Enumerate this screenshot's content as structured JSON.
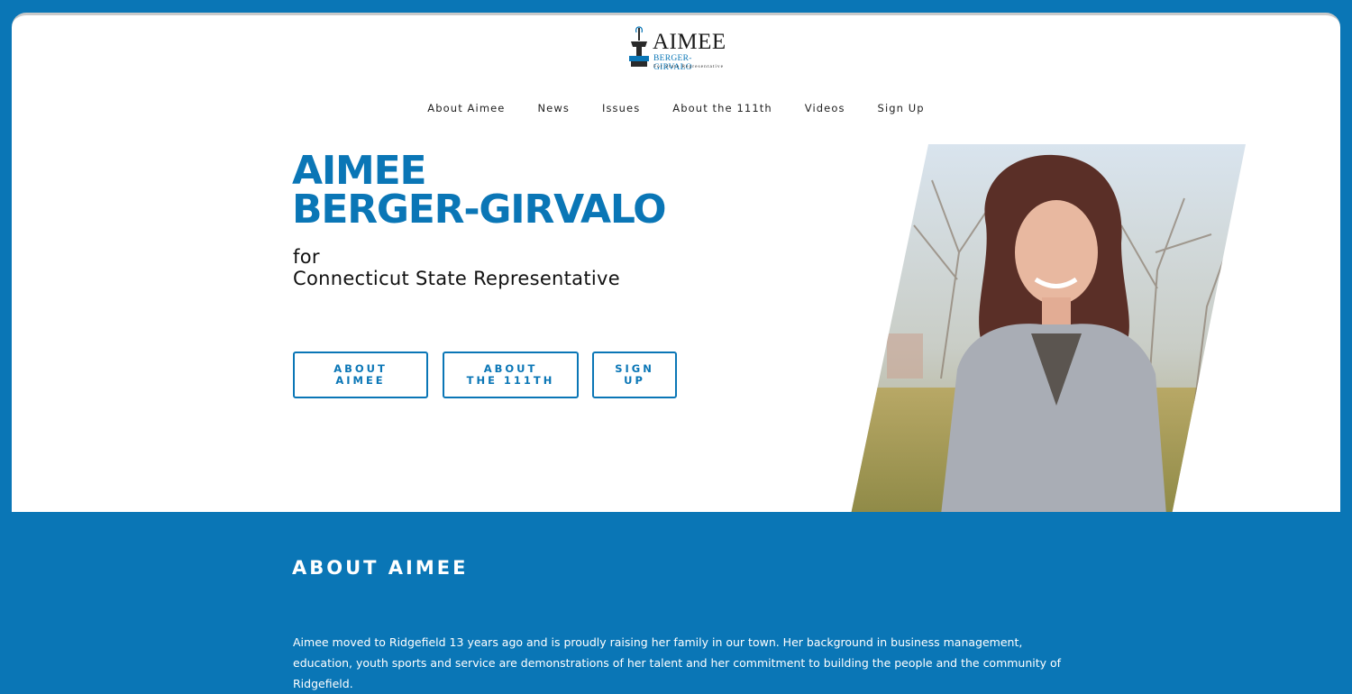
{
  "logo": {
    "name": "AIMEE",
    "subname": "BERGER-GIRVALO",
    "tagline": "For State Representative"
  },
  "nav": {
    "items": [
      "About Aimee",
      "News",
      "Issues",
      "About the 111th",
      "Videos",
      "Sign Up"
    ]
  },
  "hero": {
    "title_line1": "AIMEE",
    "title_line2": "BERGER-GIRVALO",
    "subtitle_line1": "for",
    "subtitle_line2": "Connecticut State Representative",
    "buttons": [
      {
        "line1": "ABOUT",
        "line2": "AIMEE"
      },
      {
        "line1": "ABOUT",
        "line2": "THE 111TH"
      },
      {
        "line1": "SIGN",
        "line2": "UP"
      }
    ]
  },
  "about": {
    "heading": "ABOUT AIMEE",
    "body": "Aimee moved to Ridgefield 13 years ago and is proudly raising her family in our town. Her background in business management, education, youth sports and service are demonstrations of her talent and her commitment to building the people and the community of Ridgefield."
  },
  "colors": {
    "brand_blue": "#0a76b6",
    "background_white": "#ffffff",
    "text_dark": "#111111"
  },
  "icons": [
    "fountain-logo-icon"
  ]
}
